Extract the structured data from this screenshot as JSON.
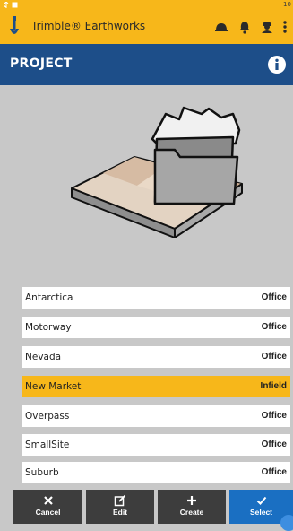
{
  "statusbar": {
    "left_icons": [
      "usb-icon",
      "image-icon"
    ],
    "time": "10"
  },
  "appbar": {
    "title": "Trimble® Earthworks",
    "icons": [
      "helmet-icon",
      "bell-icon",
      "operator-icon",
      "more-icon"
    ],
    "brand_color": "#f7b71a"
  },
  "header": {
    "title": "PROJECT",
    "info_icon": "info-icon",
    "color": "#1d4e89"
  },
  "illustration": {
    "icon": "project-folder-terrain-icon"
  },
  "projects": [
    {
      "name": "Antarctica",
      "type": "Office",
      "selected": false
    },
    {
      "name": "Motorway",
      "type": "Office",
      "selected": false
    },
    {
      "name": "Nevada",
      "type": "Office",
      "selected": false
    },
    {
      "name": "New Market",
      "type": "Infield",
      "selected": true
    },
    {
      "name": "Overpass",
      "type": "Office",
      "selected": false
    },
    {
      "name": "SmallSite",
      "type": "Office",
      "selected": false
    },
    {
      "name": "Suburb",
      "type": "Office",
      "selected": false
    }
  ],
  "actions": {
    "cancel": {
      "label": "Cancel",
      "icon": "close-icon"
    },
    "edit": {
      "label": "Edit",
      "icon": "edit-icon"
    },
    "create": {
      "label": "Create",
      "icon": "plus-icon"
    },
    "select": {
      "label": "Select",
      "icon": "check-icon",
      "color": "#1a6fc2"
    }
  }
}
